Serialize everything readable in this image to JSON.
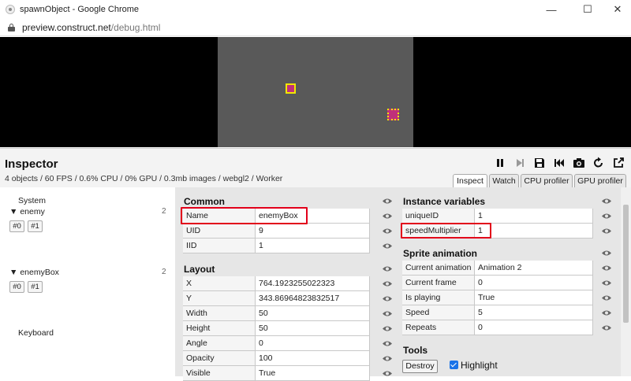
{
  "window": {
    "title": "spawnObject - Google Chrome",
    "url_host": "preview.construct.net",
    "url_path": "/debug.html"
  },
  "inspector": {
    "title": "Inspector",
    "stats": "4 objects / 60 FPS / 0.6% CPU / 0% GPU / 0.3mb images / webgl2 / Worker",
    "toolbar": [
      "pause-icon",
      "step-icon",
      "save-icon",
      "rewind-icon",
      "camera-icon",
      "restart-icon",
      "popout-icon"
    ],
    "tabs": [
      "Inspect",
      "Watch",
      "CPU profiler",
      "GPU profiler"
    ],
    "active_tab": "Inspect"
  },
  "tree": {
    "system": "System",
    "enemy": {
      "label": "enemy",
      "count": "2",
      "instances": [
        "#0",
        "#1"
      ]
    },
    "enemyBox": {
      "label": "enemyBox",
      "count": "2",
      "instances": [
        "#0",
        "#1"
      ]
    },
    "keyboard": "Keyboard"
  },
  "common": {
    "title": "Common",
    "rows": [
      {
        "key": "Name",
        "value": "enemyBox"
      },
      {
        "key": "UID",
        "value": "9"
      },
      {
        "key": "IID",
        "value": "1"
      }
    ]
  },
  "layout": {
    "title": "Layout",
    "rows": [
      {
        "key": "X",
        "value": "764.1923255022323"
      },
      {
        "key": "Y",
        "value": "343.86964823832517"
      },
      {
        "key": "Width",
        "value": "50"
      },
      {
        "key": "Height",
        "value": "50"
      },
      {
        "key": "Angle",
        "value": "0"
      },
      {
        "key": "Opacity",
        "value": "100"
      },
      {
        "key": "Visible",
        "value": "True"
      }
    ]
  },
  "instance_vars": {
    "title": "Instance variables",
    "rows": [
      {
        "key": "uniqueID",
        "value": "1"
      },
      {
        "key": "speedMultiplier",
        "value": "1"
      }
    ]
  },
  "sprite_anim": {
    "title": "Sprite animation",
    "rows": [
      {
        "key": "Current animation",
        "value": "Animation 2"
      },
      {
        "key": "Current frame",
        "value": "0"
      },
      {
        "key": "Is playing",
        "value": "True"
      },
      {
        "key": "Speed",
        "value": "5"
      },
      {
        "key": "Repeats",
        "value": "0"
      }
    ]
  },
  "tools": {
    "title": "Tools",
    "destroy": "Destroy",
    "highlight": "Highlight",
    "highlight_checked": true
  },
  "colors": {
    "highlight_box": "#e2001a",
    "sprite_fill": "#c0307a",
    "sprite_border": "#f2e600",
    "layout_bg": "#595959"
  }
}
